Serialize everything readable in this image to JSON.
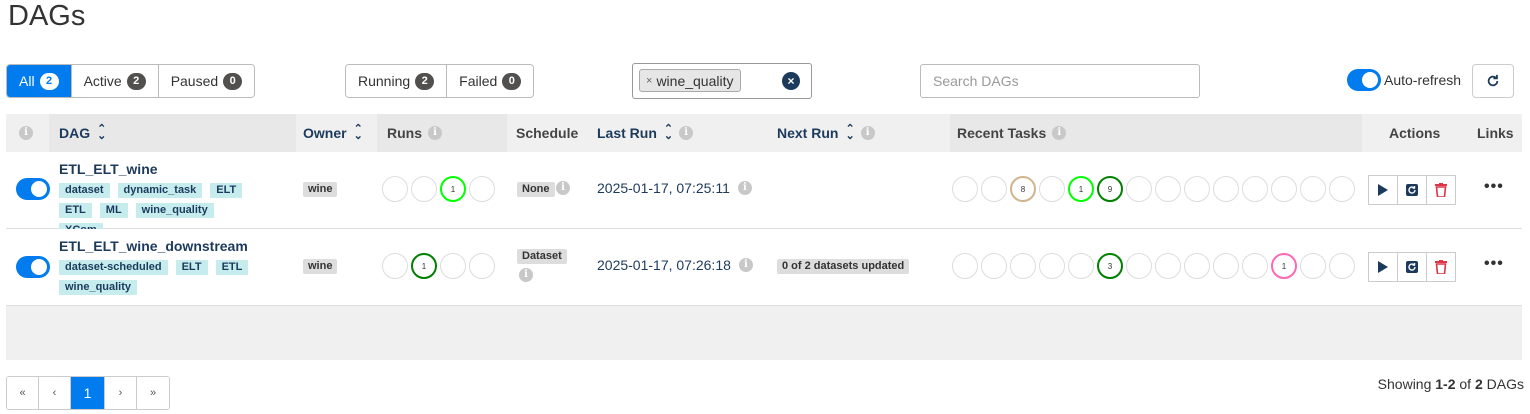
{
  "page": {
    "title": "DAGs"
  },
  "status_filter": [
    {
      "label": "All",
      "count": "2"
    },
    {
      "label": "Active",
      "count": "2"
    },
    {
      "label": "Paused",
      "count": "0"
    }
  ],
  "run_filter": [
    {
      "label": "Running",
      "count": "2"
    },
    {
      "label": "Failed",
      "count": "0"
    }
  ],
  "tag_filter": {
    "remove": "×",
    "tag": "wine_quality",
    "clear": "×"
  },
  "search": {
    "placeholder": "Search DAGs"
  },
  "auto_refresh": {
    "label": "Auto-refresh",
    "on": true
  },
  "columns": {
    "dag": "DAG",
    "owner": "Owner",
    "runs": "Runs",
    "schedule": "Schedule",
    "last_run": "Last Run",
    "next_run": "Next Run",
    "recent_tasks": "Recent Tasks",
    "actions": "Actions",
    "links": "Links"
  },
  "rows": [
    {
      "dag_id": "ETL_ELT_wine",
      "tags": [
        "dataset",
        "dynamic_task",
        "ELT",
        "ETL",
        "ML",
        "wine_quality",
        "XCom"
      ],
      "owner": "wine",
      "runs": [
        "",
        "",
        "1",
        ""
      ],
      "schedule": "None",
      "last_run": "2025-01-17, 07:25:11",
      "next_run": "",
      "recent_tasks": [
        "",
        "",
        "8",
        "",
        "1",
        "9",
        "",
        "",
        "",
        "",
        "",
        "",
        "",
        ""
      ]
    },
    {
      "dag_id": "ETL_ELT_wine_downstream",
      "tags": [
        "dataset-scheduled",
        "ELT",
        "ETL",
        "wine_quality"
      ],
      "owner": "wine",
      "runs": [
        "",
        "1",
        "",
        ""
      ],
      "schedule": "Dataset",
      "last_run": "2025-01-17, 07:26:18",
      "next_run": "0 of 2 datasets updated",
      "recent_tasks": [
        "",
        "",
        "",
        "",
        "",
        "3",
        "",
        "",
        "",
        "",
        "",
        "1",
        "",
        ""
      ]
    }
  ],
  "colors": {
    "accent": "#017cee",
    "success": "#008000",
    "running": "#00ff00",
    "upstream_failed": "#d2b48c",
    "up_for_retry": "#ff69b4",
    "delete": "#dc3545",
    "link": "#1c3a5c"
  },
  "pagination": {
    "first": "«",
    "prev": "‹",
    "current": "1",
    "next": "›",
    "last": "»"
  },
  "footer": {
    "prefix": "Showing ",
    "range": "1-2",
    "mid": " of ",
    "total": "2",
    "suffix": " DAGs"
  }
}
